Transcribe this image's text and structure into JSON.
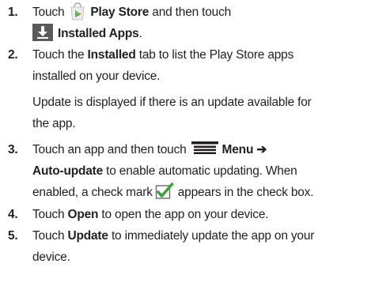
{
  "colors": {
    "text": "#231f20",
    "installed_icon_bg": "#5a5a5a",
    "checkmark_green": "#3aa535"
  },
  "icons": {
    "play_store": "play-store-icon",
    "installed_apps": "download-icon",
    "menu": "menu-icon",
    "check_box": "checked-checkbox-icon"
  },
  "steps": [
    {
      "number": "1.",
      "lines": [
        [
          "Touch",
          "Play Store",
          "and then touch"
        ],
        [
          "Installed Apps",
          "."
        ]
      ]
    },
    {
      "number": "2.",
      "lines": [
        [
          "Touch the",
          "Installed",
          "tab to list the Play Store apps"
        ],
        [
          "installed on your device."
        ],
        [
          "Update is displayed if there is an update available for"
        ],
        [
          "the app."
        ]
      ]
    },
    {
      "number": "3.",
      "lines": [
        [
          "Touch an app and then touch",
          "Menu ➔"
        ],
        [
          "Auto-update",
          "to enable automatic updating. When"
        ],
        [
          "enabled, a check mark",
          "appears in the check box."
        ]
      ]
    },
    {
      "number": "4.",
      "lines": [
        [
          "Touch",
          "Open",
          "to open the app on your device."
        ]
      ]
    },
    {
      "number": "5.",
      "lines": [
        [
          "Touch",
          "Update",
          "to immediately update the app on your"
        ],
        [
          "device."
        ]
      ]
    }
  ]
}
